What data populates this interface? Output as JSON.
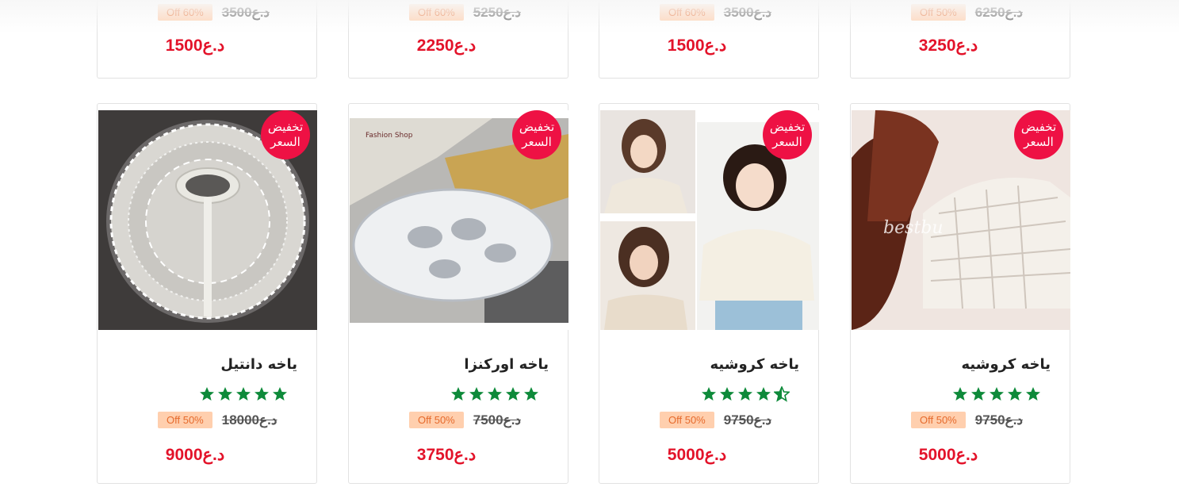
{
  "colors": {
    "accent_red": "#e3132a",
    "badge": "#ee1144",
    "off_bg": "#ffcfae",
    "off_text": "#e66a2c",
    "star": "#0e8a3a"
  },
  "top_row": [
    {
      "discount": "Off 60%",
      "old_price": "د.ع3500",
      "price": "د.ع1500"
    },
    {
      "discount": "Off 60%",
      "old_price": "د.ع5250",
      "price": "د.ع2250"
    },
    {
      "discount": "Off 60%",
      "old_price": "د.ع3500",
      "price": "د.ع1500"
    },
    {
      "discount": "Off 50%",
      "old_price": "د.ع6250",
      "price": "د.ع3250"
    }
  ],
  "products": [
    {
      "badge_line1": "تخفيض",
      "badge_line2": "السعر",
      "title": "ياخه دانتيل",
      "rating": 5,
      "discount": "Off 50%",
      "old_price": "د.ع18000",
      "price": "د.ع9000",
      "image_icon": "lace-collar-image"
    },
    {
      "badge_line1": "تخفيض",
      "badge_line2": "السعر",
      "title": "ياخه اوركنزا",
      "rating": 5,
      "discount": "Off 50%",
      "old_price": "د.ع7500",
      "price": "د.ع3750",
      "image_icon": "organza-collar-image",
      "image_text": "Fashion Shop"
    },
    {
      "badge_line1": "تخفيض",
      "badge_line2": "السعر",
      "title": "ياخه كروشيه",
      "rating": 4.5,
      "discount": "Off 50%",
      "old_price": "د.ع9750",
      "price": "د.ع5000",
      "image_icon": "crochet-models-image"
    },
    {
      "badge_line1": "تخفيض",
      "badge_line2": "السعر",
      "title": "ياخه كروشيه",
      "rating": 5,
      "discount": "Off 50%",
      "old_price": "د.ع9750",
      "price": "د.ع5000",
      "image_icon": "crochet-collar-image",
      "image_text": "bestbu"
    }
  ]
}
